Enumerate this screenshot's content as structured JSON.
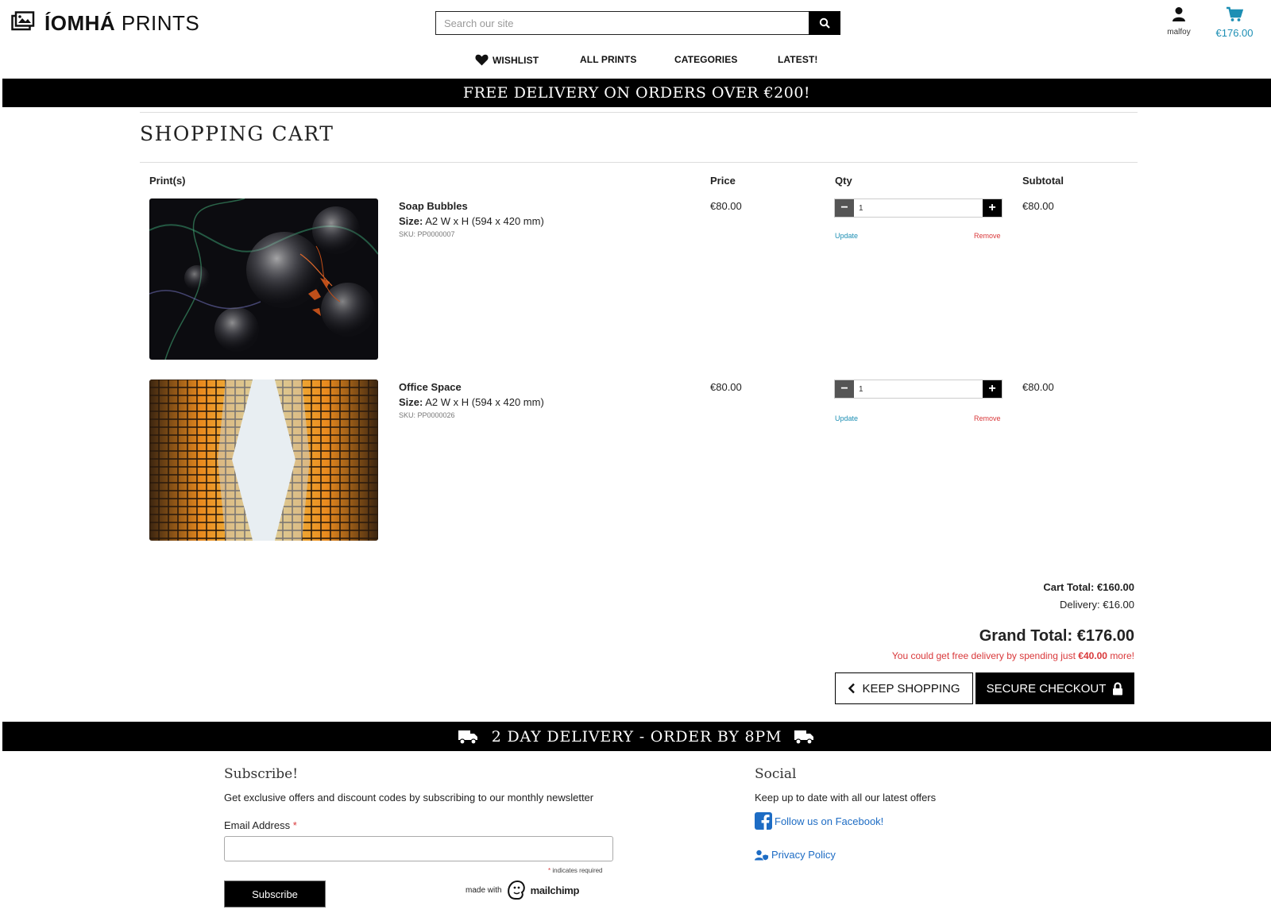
{
  "header": {
    "logo_bold": "ÍOMHÁ",
    "logo_light": "PRINTS",
    "search_placeholder": "Search our site",
    "account_label": "malfoy",
    "cart_total": "€176.00"
  },
  "nav": {
    "items": [
      {
        "label": "WISHLIST",
        "icon": "heart-icon"
      },
      {
        "label": "ALL PRINTS"
      },
      {
        "label": "CATEGORIES"
      },
      {
        "label": "LATEST!"
      }
    ]
  },
  "top_banner": "FREE DELIVERY ON ORDERS OVER €200!",
  "page_title": "SHOPPING CART",
  "table": {
    "headers": {
      "prints": "Print(s)",
      "price": "Price",
      "qty": "Qty",
      "subtotal": "Subtotal"
    }
  },
  "items": [
    {
      "name": "Soap Bubbles",
      "size_label": "Size:",
      "size_value": "A2 W x H (594 x 420 mm)",
      "sku": "SKU: PP0000007",
      "price": "€80.00",
      "qty": "1",
      "subtotal": "€80.00",
      "update_label": "Update",
      "remove_label": "Remove"
    },
    {
      "name": "Office Space",
      "size_label": "Size:",
      "size_value": "A2 W x H (594 x 420 mm)",
      "sku": "SKU: PP0000026",
      "price": "€80.00",
      "qty": "1",
      "subtotal": "€80.00",
      "update_label": "Update",
      "remove_label": "Remove"
    }
  ],
  "totals": {
    "cart_total_label": "Cart Total:",
    "cart_total": "€160.00",
    "delivery_label": "Delivery:",
    "delivery": "€16.00",
    "grand_total_label": "Grand Total:",
    "grand_total": "€176.00",
    "free_delivery_pre": "You could get free delivery by spending just",
    "free_delivery_amount": "€40.00",
    "free_delivery_post": "more!"
  },
  "buttons": {
    "keep_shopping": "KEEP SHOPPING",
    "secure_checkout": "SECURE CHECKOUT"
  },
  "bottom_banner": "2 DAY DELIVERY - ORDER BY 8PM",
  "footer": {
    "subscribe_title": "Subscribe!",
    "subscribe_text": "Get exclusive offers and discount codes by subscribing to our monthly newsletter",
    "email_label": "Email Address",
    "required_marker": "*",
    "required_note": "indicates required",
    "subscribe_button": "Subscribe",
    "made_with": "made with",
    "mailchimp_word": "mailchimp",
    "social_title": "Social",
    "social_text": "Keep up to date with all our latest offers",
    "facebook_link": "Follow us on Facebook!",
    "privacy_link": "Privacy Policy"
  },
  "colors": {
    "accent_blue": "#1d8fb4",
    "link_blue": "#1d6cc4",
    "alert_red": "#d9383a",
    "banner_black": "#000000"
  }
}
